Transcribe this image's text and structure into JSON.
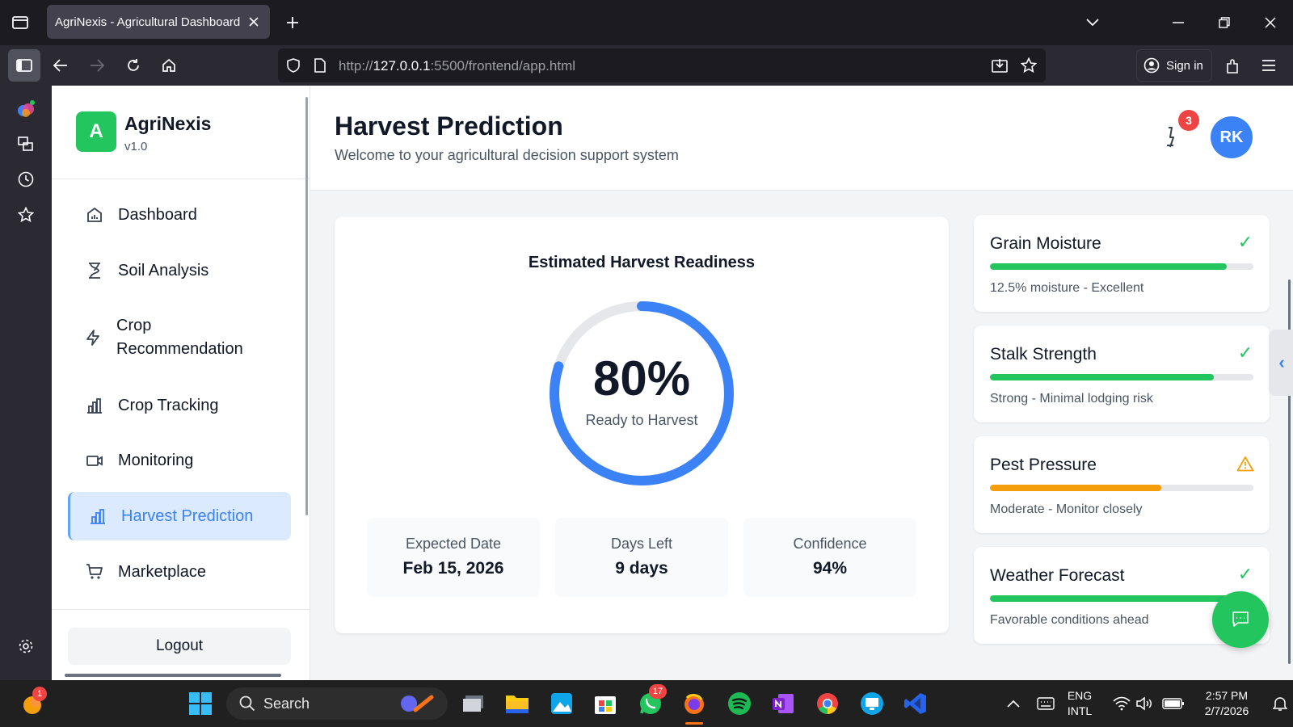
{
  "browser": {
    "tab_title": "AgriNexis - Agricultural Dashboard",
    "url_prefix": "http://",
    "url_host": "127.0.0.1",
    "url_rest": ":5500/frontend/app.html",
    "signin_label": "Sign in"
  },
  "sidebar": {
    "logo_letter": "A",
    "brand": "AgriNexis",
    "version": "v1.0",
    "items": [
      {
        "label": "Dashboard",
        "icon": "home-chart-icon"
      },
      {
        "label": "Soil Analysis",
        "icon": "hourglass-icon"
      },
      {
        "label": "Crop Recommendation",
        "icon": "lightning-icon"
      },
      {
        "label": "Crop Tracking",
        "icon": "bar-chart-icon"
      },
      {
        "label": "Monitoring",
        "icon": "video-camera-icon"
      },
      {
        "label": "Harvest Prediction",
        "icon": "bar-chart-icon",
        "active": true
      },
      {
        "label": "Marketplace",
        "icon": "shopping-cart-icon"
      }
    ],
    "logout_label": "Logout"
  },
  "header": {
    "title": "Harvest Prediction",
    "subtitle": "Welcome to your agricultural decision support system",
    "notification_count": "3",
    "avatar_initials": "RK"
  },
  "readiness": {
    "title": "Estimated Harvest Readiness",
    "value_text": "80%",
    "value": 0.8,
    "caption": "Ready to Harvest",
    "stats": [
      {
        "label": "Expected Date",
        "value": "Feb 15, 2026"
      },
      {
        "label": "Days Left",
        "value": "9 days"
      },
      {
        "label": "Confidence",
        "value": "94%"
      }
    ]
  },
  "indicators": [
    {
      "title": "Grain Moisture",
      "desc": "12.5% moisture - Excellent",
      "level": 0.9,
      "status": "check-icon",
      "color": "#22c55e"
    },
    {
      "title": "Stalk Strength",
      "desc": "Strong - Minimal lodging risk",
      "level": 0.85,
      "status": "check-icon",
      "color": "#22c55e"
    },
    {
      "title": "Pest Pressure",
      "desc": "Moderate - Monitor closely",
      "level": 0.65,
      "status": "warning-icon",
      "color": "#f59e0b"
    },
    {
      "title": "Weather Forecast",
      "desc": "Favorable conditions ahead",
      "level": 0.95,
      "status": "check-icon",
      "color": "#22c55e"
    }
  ],
  "colors": {
    "accent": "#3b82f6",
    "success": "#22c55e",
    "warning": "#f59e0b",
    "danger": "#ef4444"
  },
  "taskbar": {
    "start_badge": "1",
    "search_label": "Search",
    "whatsapp_badge": "17",
    "lang_1": "ENG",
    "lang_2": "INTL",
    "time": "2:57 PM",
    "date": "2/7/2026"
  }
}
